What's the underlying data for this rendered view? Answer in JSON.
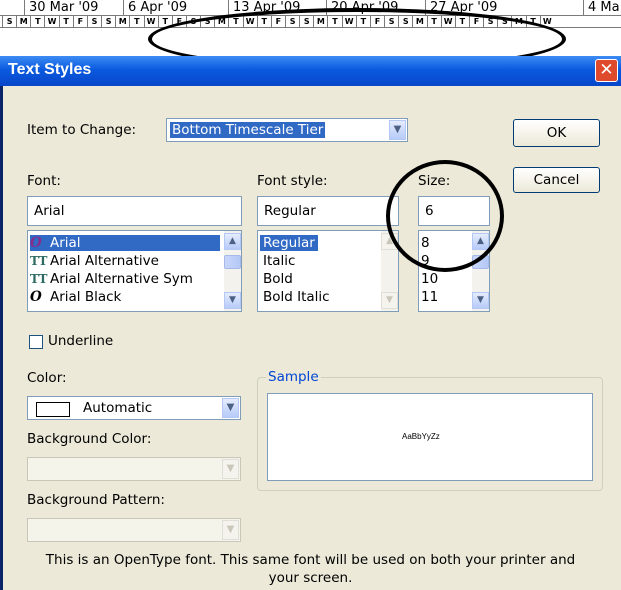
{
  "timescale": {
    "weeks": [
      "30 Mar '09",
      "6 Apr '09",
      "13 Apr '09",
      "20 Apr '09",
      "27 Apr '09",
      "4 Ma"
    ],
    "days": [
      "S",
      "M",
      "T",
      "W",
      "T",
      "F",
      "S",
      "S",
      "M",
      "T",
      "W",
      "T",
      "F",
      "S",
      "S",
      "M",
      "T",
      "W",
      "T",
      "F",
      "S",
      "S",
      "M",
      "T",
      "W",
      "T",
      "F",
      "S",
      "S",
      "M",
      "T",
      "W",
      "T",
      "F",
      "S",
      "S",
      "M",
      "T",
      "W"
    ]
  },
  "dialog": {
    "title": "Text Styles",
    "item_to_change_label": "Item to Change:",
    "item_to_change_value": "Bottom Timescale Tier",
    "ok_label": "OK",
    "cancel_label": "Cancel",
    "font_label": "Font:",
    "font_value": "Arial",
    "font_list": [
      {
        "name": "Arial",
        "icon": "opentype-icon"
      },
      {
        "name": "Arial Alternative",
        "icon": "truetype-icon"
      },
      {
        "name": "Arial Alternative Sym",
        "icon": "truetype-icon"
      },
      {
        "name": "Arial Black",
        "icon": "opentype-icon"
      }
    ],
    "font_style_label": "Font style:",
    "font_style_value": "Regular",
    "font_style_list": [
      "Regular",
      "Italic",
      "Bold",
      "Bold Italic"
    ],
    "size_label": "Size:",
    "size_value": "6",
    "size_list": [
      "8",
      "9",
      "10",
      "11"
    ],
    "underline_label": "Underline",
    "color_label": "Color:",
    "color_value": "Automatic",
    "background_color_label": "Background Color:",
    "background_pattern_label": "Background Pattern:",
    "sample_label": "Sample",
    "sample_text": "AaBbYyZz",
    "note_line1": "This is an OpenType font. This same font will be used on both your printer and",
    "note_line2": "your screen."
  },
  "colors": {
    "title_bar": "#0a5adf",
    "close_button": "#e04a2c",
    "selection": "#316ac5",
    "dialog_bg": "#ece9d8",
    "sample_legend": "#0046d5"
  }
}
